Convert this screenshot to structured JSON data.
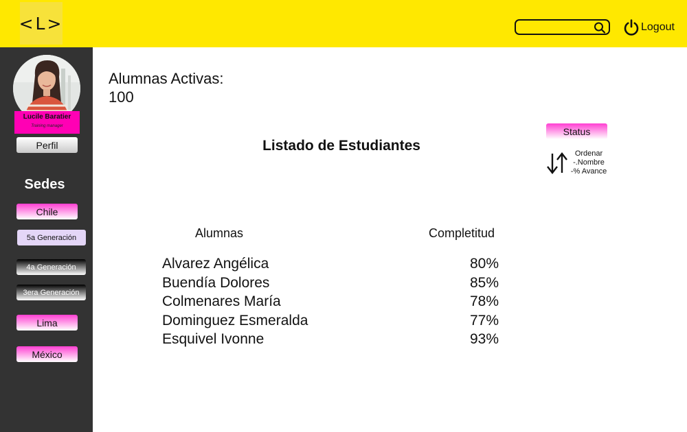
{
  "header": {
    "logo_text": "<L>",
    "search": {
      "value": "",
      "placeholder": ""
    },
    "logout_label": "Logout",
    "background": "#ffe800"
  },
  "sidebar": {
    "profile": {
      "name": "Lucile Baratier",
      "role": "Training manager"
    },
    "profile_button": "Perfil",
    "sedes_title": "Sedes",
    "items": [
      {
        "label": "Chile"
      },
      {
        "label": "5a Generación"
      },
      {
        "label": "4a Generación"
      },
      {
        "label": "3era Generación"
      },
      {
        "label": "Lima"
      },
      {
        "label": "México"
      }
    ]
  },
  "main": {
    "active_label": "Alumnas Activas:",
    "active_count": "100",
    "list_title": "Listado de Estudiantes",
    "status_button": "Status",
    "sort": {
      "title": "Ordenar",
      "option1": "-.Nombre",
      "option2": "-% Avance"
    },
    "columns": {
      "students": "Alumnas",
      "completion": "Completitud"
    },
    "students": [
      {
        "name": "Alvarez Angélica",
        "pct": "80%"
      },
      {
        "name": "Buendía Dolores",
        "pct": "85%"
      },
      {
        "name": "Colmenares María",
        "pct": "78%"
      },
      {
        "name": "Dominguez Esmeralda",
        "pct": "77%"
      },
      {
        "name": "Esquivel Ivonne",
        "pct": "93%"
      }
    ]
  },
  "icons": [
    "search-icon",
    "power-icon",
    "sort-arrows-icon"
  ],
  "colors": {
    "accent_yellow": "#ffe800",
    "pink": "#ff00b4",
    "sidebar": "#333333"
  }
}
